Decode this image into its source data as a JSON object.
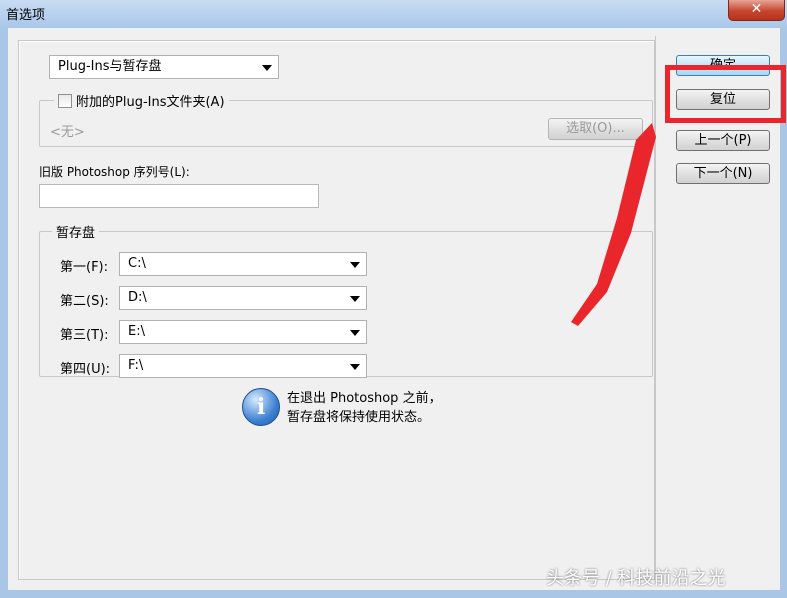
{
  "window": {
    "title": "首选项",
    "close_glyph": "✕"
  },
  "panel": {
    "section_select": "Plug-Ins与暂存盘",
    "plugins_checkbox_label": "附加的Plug-Ins文件夹(A)",
    "plugins_folder_value": "<无>",
    "choose_button": "选取(O)...",
    "serial_label": "旧版 Photoshop 序列号(L):",
    "serial_value": "",
    "scratch_legend": "暂存盘",
    "scratch_disks": [
      {
        "label": "第一(F):",
        "value": "C:\\"
      },
      {
        "label": "第二(S):",
        "value": "D:\\"
      },
      {
        "label": "第三(T):",
        "value": "E:\\"
      },
      {
        "label": "第四(U):",
        "value": "F:\\"
      }
    ],
    "info_line1": "在退出 Photoshop 之前，",
    "info_line2": "暂存盘将保持使用状态。"
  },
  "side_buttons": {
    "ok": "确定",
    "reset": "复位",
    "prev": "上一个(P)",
    "next": "下一个(N)"
  },
  "annotation": {
    "highlight_color": "#e8262b"
  },
  "watermark": "头条号 / 科技前沿之光"
}
